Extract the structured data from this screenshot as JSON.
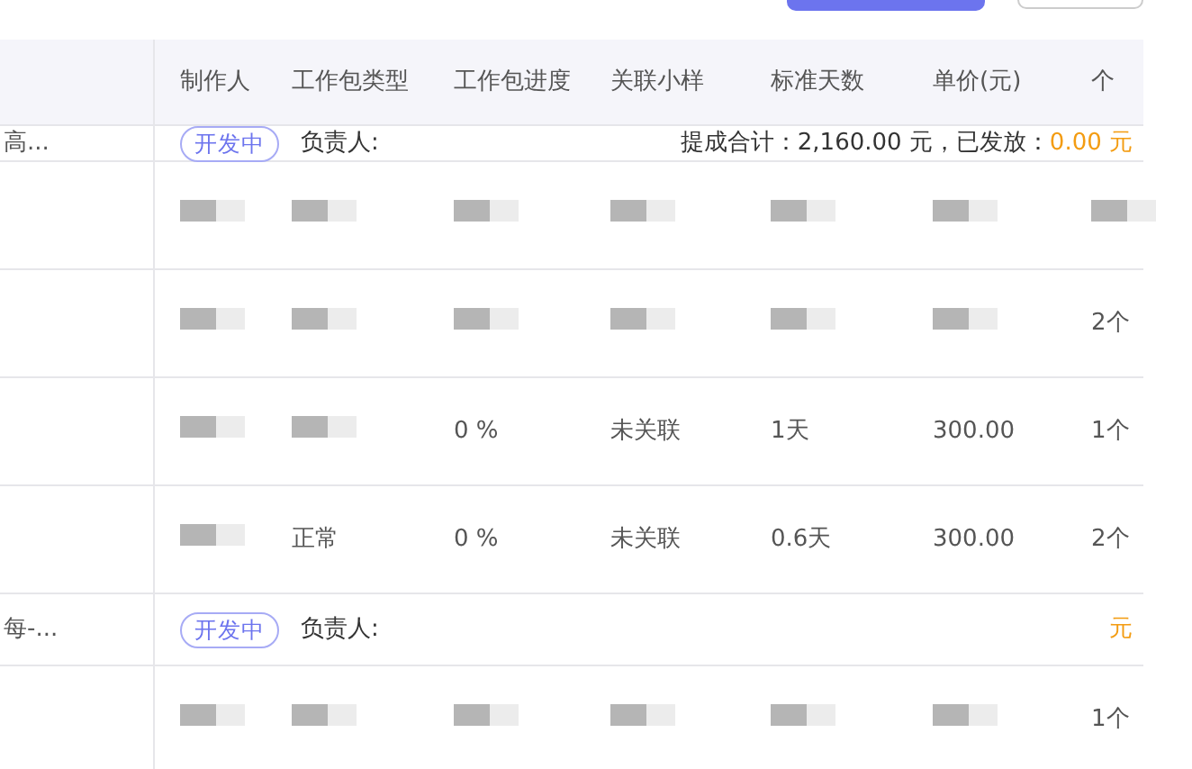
{
  "table": {
    "columns": [
      "制作人",
      "工作包类型",
      "工作包进度",
      "关联小样",
      "标准天数",
      "单价(元)",
      "个"
    ],
    "rows": [
      {
        "kind": "group",
        "title": "高...",
        "status": "开发中",
        "owner_label": "负责人:",
        "summary": "提成合计：2,160.00 元，已发放：",
        "amount": "0.00 元"
      },
      {
        "kind": "item",
        "cells": {}
      },
      {
        "kind": "item",
        "cells": {
          "count": "2个"
        }
      },
      {
        "kind": "item",
        "cells": {
          "progress": "0 %",
          "sample": "未关联",
          "days": "1天",
          "price": "300.00",
          "count": "1个"
        }
      },
      {
        "kind": "item",
        "cells": {
          "type": "正常",
          "progress": "0 %",
          "sample": "未关联",
          "days": "0.6天",
          "price": "300.00",
          "count": "2个"
        }
      },
      {
        "kind": "group",
        "title": "每-...",
        "status": "开发中",
        "owner_label": "负责人:",
        "amount": "元"
      },
      {
        "kind": "item",
        "cells": {
          "count": "1个"
        }
      }
    ]
  }
}
